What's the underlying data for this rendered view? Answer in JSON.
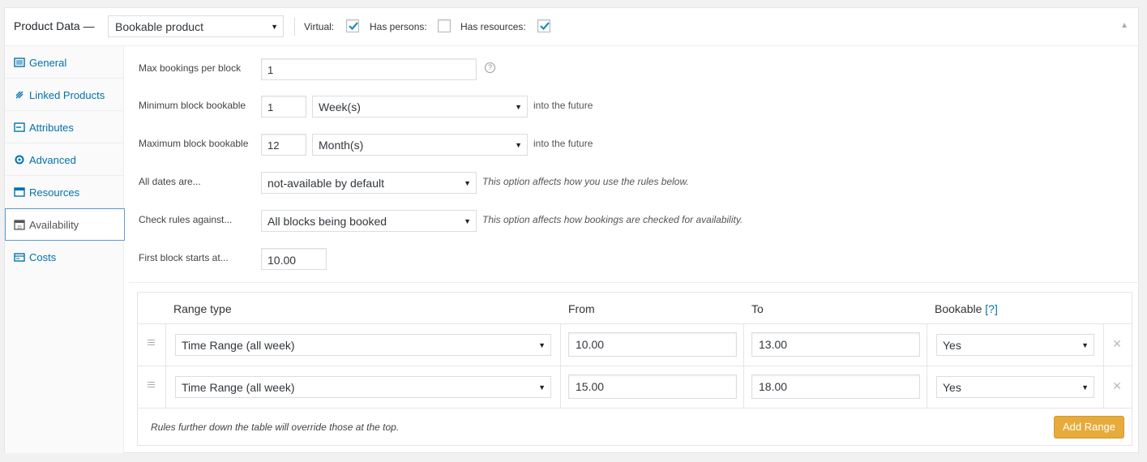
{
  "header": {
    "title": "Product Data —",
    "product_type": "Bookable product",
    "virtual_label": "Virtual:",
    "virtual_checked": true,
    "persons_label": "Has persons:",
    "persons_checked": false,
    "resources_label": "Has resources:",
    "resources_checked": true
  },
  "sidebar": {
    "items": [
      {
        "label": "General",
        "icon": "general-icon"
      },
      {
        "label": "Linked Products",
        "icon": "link-icon"
      },
      {
        "label": "Attributes",
        "icon": "attributes-icon"
      },
      {
        "label": "Advanced",
        "icon": "gear-icon"
      },
      {
        "label": "Resources",
        "icon": "resources-icon"
      },
      {
        "label": "Availability",
        "icon": "calendar-icon",
        "active": true
      },
      {
        "label": "Costs",
        "icon": "costs-icon"
      }
    ]
  },
  "fields": {
    "max_bookings": {
      "label": "Max bookings per block",
      "value": "1"
    },
    "min_block": {
      "label": "Minimum block bookable",
      "value": "1",
      "unit": "Week(s)",
      "suffix": "into the future"
    },
    "max_block": {
      "label": "Maximum block bookable",
      "value": "12",
      "unit": "Month(s)",
      "suffix": "into the future"
    },
    "all_dates": {
      "label": "All dates are...",
      "value": "not-available by default",
      "hint": "This option affects how you use the rules below."
    },
    "check_rules": {
      "label": "Check rules against...",
      "value": "All blocks being booked",
      "hint": "This option affects how bookings are checked for availability."
    },
    "first_block": {
      "label": "First block starts at...",
      "value": "10.00"
    }
  },
  "table": {
    "headers": {
      "range_type": "Range type",
      "from": "From",
      "to": "To",
      "bookable": "Bookable",
      "help": "[?]"
    },
    "rows": [
      {
        "range_type": "Time Range (all week)",
        "from": "10.00",
        "to": "13.00",
        "bookable": "Yes"
      },
      {
        "range_type": "Time Range (all week)",
        "from": "15.00",
        "to": "18.00",
        "bookable": "Yes"
      }
    ],
    "note": "Rules further down the table will override those at the top.",
    "add_button": "Add Range"
  },
  "colors": {
    "accent": "#0073aa",
    "button": "#e6ab3a",
    "active_border": "#5b9dd9"
  }
}
